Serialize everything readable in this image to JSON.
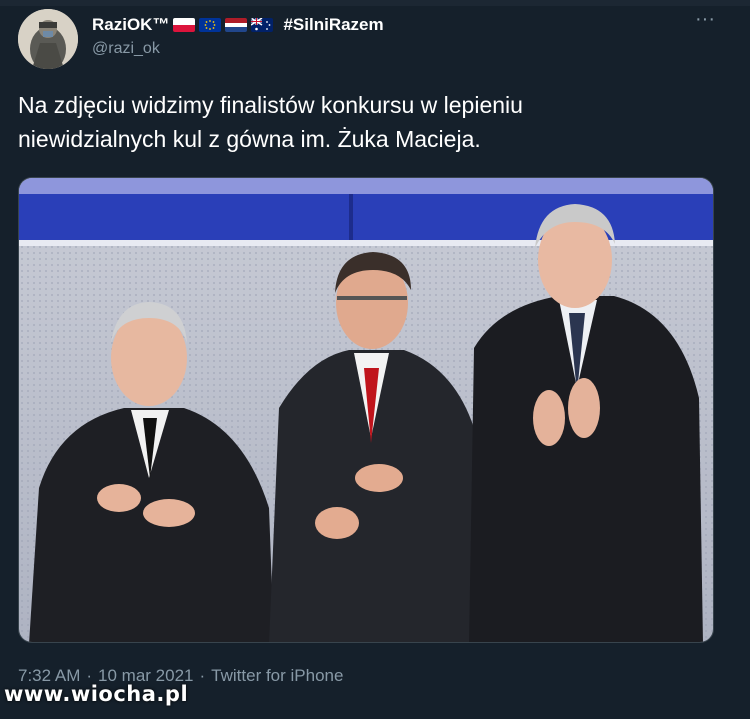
{
  "tweet": {
    "display_name": "RaziOK™",
    "hashtag": "#SilniRazem",
    "handle": "@razi_ok",
    "more_icon": "···",
    "flags": [
      "poland-flag-icon",
      "eu-flag-icon",
      "netherlands-flag-icon",
      "uk-australia-flag-icon"
    ],
    "text_line1": "Na zdjęciu widzimy finalistów konkursu w lepieniu",
    "text_line2": "niewidzialnych kul z gówna im. Żuka Macieja.",
    "time": "7:32 AM",
    "separator": "·",
    "date": "10 mar 2021",
    "source": "Twitter for iPhone"
  },
  "watermark": "www.wiocha.pl",
  "colors": {
    "background": "#15202b",
    "secondary_text": "#8899a6",
    "stage_blue": "#2a3fb8"
  }
}
